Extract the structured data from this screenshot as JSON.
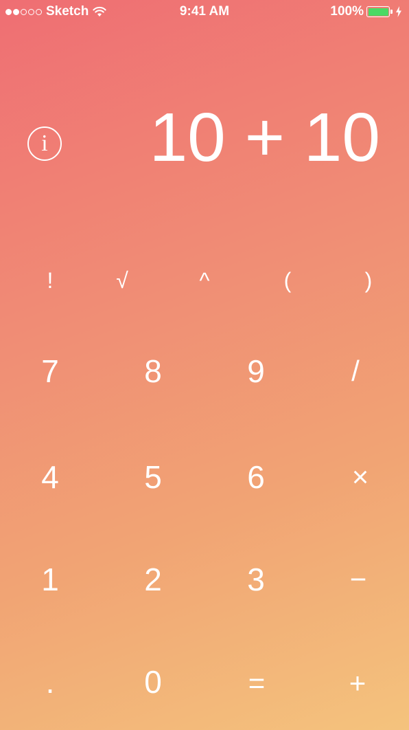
{
  "status_bar": {
    "carrier": "Sketch",
    "time": "9:41 AM",
    "battery_percent": "100%",
    "signal_strength": 2,
    "battery_level": 1.0,
    "battery_color": "#4CD964",
    "icons": [
      "signal-icon",
      "wifi-icon",
      "battery-icon",
      "charging-bolt-icon"
    ]
  },
  "display": {
    "expression": "10 + 10",
    "info_label": "i"
  },
  "keypad": {
    "functions": {
      "factorial": "!",
      "sqrt": "√",
      "power": "^",
      "open_paren": "(",
      "close_paren": ")"
    },
    "digits": {
      "d0": "0",
      "d1": "1",
      "d2": "2",
      "d3": "3",
      "d4": "4",
      "d5": "5",
      "d6": "6",
      "d7": "7",
      "d8": "8",
      "d9": "9",
      "decimal": "."
    },
    "operators": {
      "divide": "/",
      "multiply": "×",
      "subtract": "−",
      "add": "+",
      "equals": "="
    }
  },
  "theme": {
    "gradient_top": "#EF6E73",
    "gradient_bottom": "#F4C37D",
    "text_color": "#FFFFFF"
  }
}
